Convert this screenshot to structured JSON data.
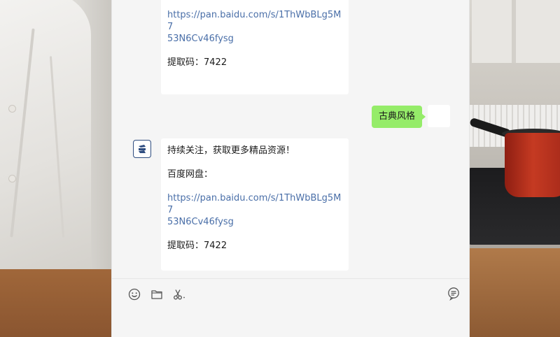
{
  "conversation": {
    "top_message": {
      "link_line1": "https://pan.baidu.com/s/1ThWbBLg5M7",
      "link_line2": "53N6Cv46fysg",
      "code": "提取码：7422"
    },
    "outgoing_message": "古典风格",
    "bottom_message": {
      "intro": "持续关注，获取更多精品资源！",
      "disk_label": "百度网盘：",
      "link_line1": "https://pan.baidu.com/s/1ThWbBLg5M7",
      "link_line2": "53N6Cv46fysg",
      "code": "提取码：7422"
    }
  },
  "toolbar": {
    "icons": [
      "emoji-icon",
      "folder-icon",
      "scissors-icon"
    ],
    "history_icon": "chat-history-icon"
  },
  "colors": {
    "outgoing_bubble": "#95ec69",
    "link": "#4a6fa8",
    "chat_bg": "#f5f5f5"
  }
}
